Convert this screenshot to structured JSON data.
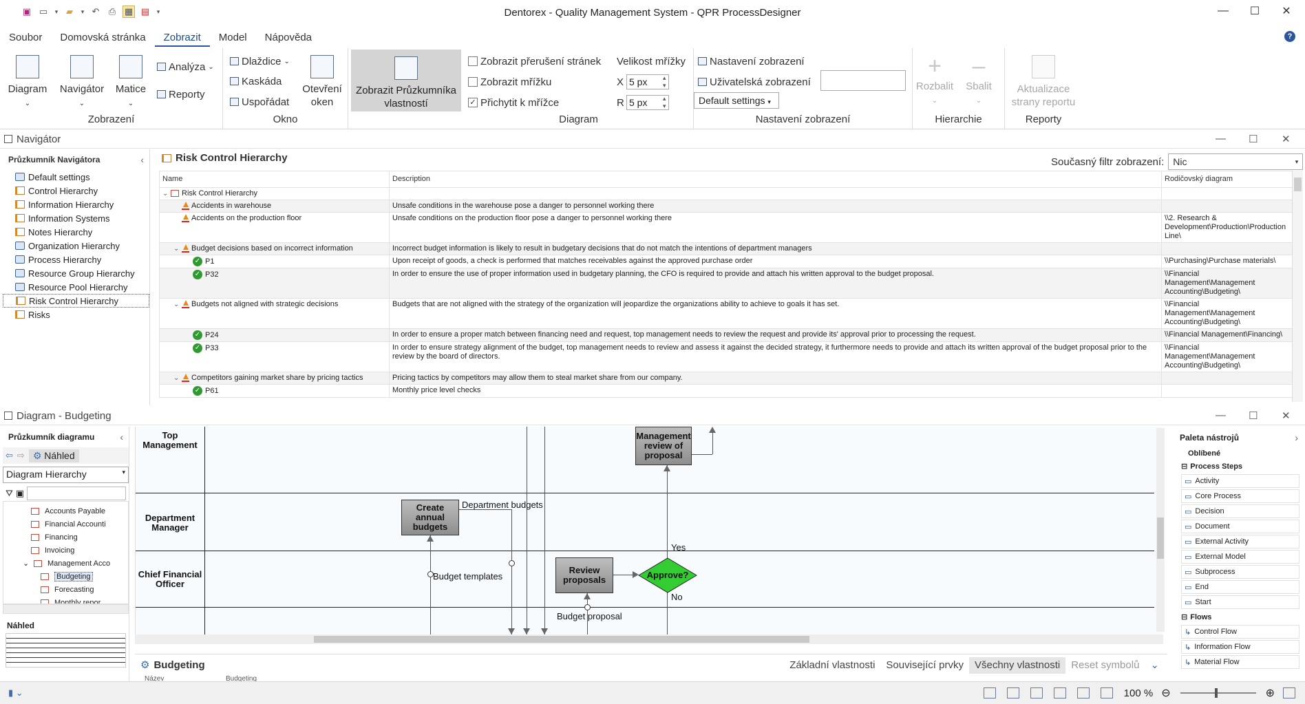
{
  "window": {
    "title": "Dentorex - Quality Management System -  QPR ProcessDesigner",
    "controls": {
      "minimize": "—",
      "maximize": "☐",
      "close": "✕"
    }
  },
  "qat": {
    "icons": [
      "save-icon",
      "new-icon",
      "open-icon",
      "undo-icon",
      "print-icon",
      "frame-icon",
      "export-icon"
    ]
  },
  "tabs": [
    "Soubor",
    "Domovská stránka",
    "Zobrazit",
    "Model",
    "Nápověda"
  ],
  "active_tab": "Zobrazit",
  "ribbon": {
    "zobrazeni": {
      "label": "Zobrazení",
      "diagram": "Diagram",
      "navigator": "Navigátor",
      "matice": "Matice",
      "analyza": "Analýza",
      "reporty": "Reporty"
    },
    "okno": {
      "label": "Okno",
      "dlazdice": "Dlaždice",
      "kaskada": "Kaskáda",
      "usporadat": "Uspořádat",
      "otevreni_oken": "Otevření oken"
    },
    "pruzkumnik": {
      "label": "Zobrazit Průzkumníka vlastností"
    },
    "diagram": {
      "label": "Diagram",
      "prerus": "Zobrazit přerušení stránek",
      "mrizka": "Zobrazit mřížku",
      "prichytit": "Přichytit k mřížce",
      "prichytit_checked": true,
      "velikost": "Velikost mřížky",
      "x_label": "X",
      "x_value": "5 px",
      "y_label": "R",
      "y_value": "5 px"
    },
    "nastaveni": {
      "label": "Nastavení zobrazení",
      "nastaveni_zobrazeni": "Nastavení zobrazení",
      "uzivatelska": "Uživatelská zobrazení",
      "default": "Default settings"
    },
    "hierarchie": {
      "label": "Hierarchie",
      "rozbalit": "Rozbalit",
      "sbalit": "Sbalit"
    },
    "reporty": {
      "label": "Reporty",
      "aktualizace": "Aktualizace strany reportu"
    }
  },
  "navigator": {
    "panel_title": "Navigátor",
    "explorer_title": "Průzkumník Navigátora",
    "items": [
      {
        "label": "Default settings",
        "icon": "settings-icon"
      },
      {
        "label": "Control Hierarchy",
        "icon": "hierarchy-icon"
      },
      {
        "label": "Information Hierarchy",
        "icon": "hierarchy-icon"
      },
      {
        "label": "Information Systems",
        "icon": "hierarchy-icon"
      },
      {
        "label": "Notes Hierarchy",
        "icon": "hierarchy-icon"
      },
      {
        "label": "Organization Hierarchy",
        "icon": "settings-icon"
      },
      {
        "label": "Process Hierarchy",
        "icon": "settings-icon"
      },
      {
        "label": "Resource Group Hierarchy",
        "icon": "settings-icon"
      },
      {
        "label": "Resource Pool Hierarchy",
        "icon": "settings-icon"
      },
      {
        "label": "Risk Control Hierarchy",
        "icon": "hierarchy-icon"
      },
      {
        "label": "Risks",
        "icon": "hierarchy-icon"
      }
    ],
    "selected_index": 9,
    "grid_title": "Risk Control Hierarchy",
    "filter_label": "Současný filtr zobrazení:",
    "filter_value": "Nic",
    "columns": [
      "Name",
      "Description",
      "Rodičovský diagram"
    ],
    "rows": [
      {
        "name": "Risk Control Hierarchy",
        "indent": 0,
        "type": "folder",
        "caret": "v",
        "desc": "",
        "parent": ""
      },
      {
        "name": "Accidents in warehouse",
        "indent": 1,
        "type": "risk",
        "caret": "",
        "desc": "Unsafe conditions in the warehouse pose a danger to personnel working there",
        "parent": ""
      },
      {
        "name": "Accidents on the production floor",
        "indent": 1,
        "type": "risk",
        "caret": "",
        "desc": "Unsafe conditions on the production floor pose a danger to personnel working there",
        "parent": "\\\\2. Research & Development\\Production\\Production Line\\"
      },
      {
        "name": "Budget decisions based on incorrect information",
        "indent": 1,
        "type": "risk",
        "caret": "v",
        "desc": "Incorrect budget information is likely to result in budgetary decisions that do not match the intentions of department managers",
        "parent": ""
      },
      {
        "name": "P1",
        "indent": 2,
        "type": "control",
        "caret": "",
        "desc": "Upon receipt of goods, a check is performed that matches receivables against the approved purchase order",
        "parent": "\\\\Purchasing\\Purchase materials\\"
      },
      {
        "name": "P32",
        "indent": 2,
        "type": "control",
        "caret": "",
        "desc": "In order to ensure the use of proper information used in budgetary planning, the CFO is required to provide and attach his written approval to the budget proposal.",
        "parent": "\\\\Financial Management\\Management Accounting\\Budgeting\\"
      },
      {
        "name": "Budgets not aligned with strategic decisions",
        "indent": 1,
        "type": "risk",
        "caret": "v",
        "desc": "Budgets that are not aligned with the strategy of the organization will jeopardize the organizations ability to achieve to goals it has set.",
        "parent": "\\\\Financial Management\\Management Accounting\\Budgeting\\"
      },
      {
        "name": "P24",
        "indent": 2,
        "type": "control",
        "caret": "",
        "desc": "In order to ensure a proper match between financing need and request, top management needs to review the request and provide its' approval prior to processing the request.",
        "parent": "\\\\Financial Management\\Financing\\"
      },
      {
        "name": "P33",
        "indent": 2,
        "type": "control",
        "caret": "",
        "desc": "In order to ensure strategy alignment of the budget, top management needs to review and assess it against the decided strategy, it furthermore needs to provide and attach its written approval of the budget proposal prior to the review by the board of directors.",
        "parent": "\\\\Financial Management\\Management Accounting\\Budgeting\\"
      },
      {
        "name": "Competitors gaining market share by pricing tactics",
        "indent": 1,
        "type": "risk",
        "caret": "v",
        "desc": "Pricing tactics by competitors may allow them to steal market share from our company.",
        "parent": ""
      },
      {
        "name": "P61",
        "indent": 2,
        "type": "control",
        "caret": "",
        "desc": "Monthly price level checks",
        "parent": ""
      }
    ]
  },
  "diagram": {
    "panel_title": "Diagram - Budgeting",
    "explorer_title": "Průzkumník diagramu",
    "nahled_btn": "Náhled",
    "hierarchy_select": "Diagram Hierarchy",
    "tree": [
      {
        "label": "Accounts Payable",
        "indent": 2
      },
      {
        "label": "Financial Accounti",
        "indent": 2
      },
      {
        "label": "Financing",
        "indent": 2
      },
      {
        "label": "Invoicing",
        "indent": 2
      },
      {
        "label": "Management Acco",
        "indent": 2,
        "caret": "v"
      },
      {
        "label": "Budgeting",
        "indent": 3,
        "selected": true
      },
      {
        "label": "Forecasting",
        "indent": 3
      },
      {
        "label": "Monthly repor",
        "indent": 3
      }
    ],
    "preview_label": "Náhled",
    "lanes": [
      "Top Management",
      "Department Manager",
      "Chief Financial Officer"
    ],
    "shapes": {
      "mgmt_review": "Management review of proposal",
      "create_budgets": "Create annual budgets",
      "review_proposals": "Review proposals",
      "approve": "Approve?"
    },
    "labels": {
      "dept_budgets": "Department budgets",
      "budget_templates": "Budget templates",
      "yes": "Yes",
      "no": "No",
      "budget_proposal": "Budget proposal"
    },
    "colors": {
      "decision": "#33cc33",
      "activity": "#a8a8a8"
    }
  },
  "palette": {
    "title": "Paleta nástrojů",
    "favorites": "Oblíbené",
    "cat_steps": "Process Steps",
    "steps": [
      "Activity",
      "Core Process",
      "Decision",
      "Document",
      "External Activity",
      "External Model",
      "Subprocess",
      "End",
      "Start"
    ],
    "cat_flows": "Flows",
    "flows": [
      "Control Flow",
      "Information Flow",
      "Material Flow"
    ]
  },
  "properties": {
    "title": "Budgeting",
    "tabs": [
      "Základní vlastnosti",
      "Související prvky",
      "Všechny vlastnosti",
      "Reset symbolů"
    ],
    "active_tab": "Všechny vlastnosti",
    "row_key": "Název",
    "row_val": "Budgeting"
  },
  "status": {
    "zoom": "100 %"
  }
}
